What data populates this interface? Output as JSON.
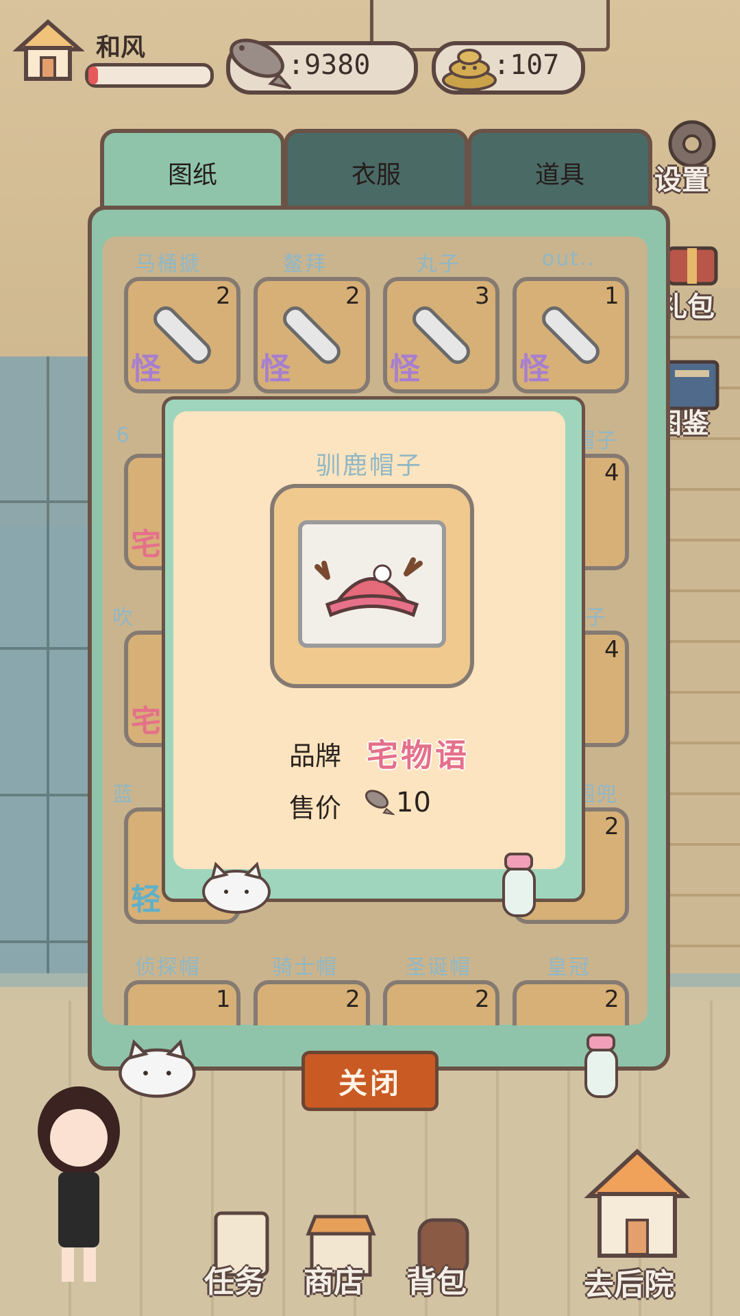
{
  "player": {
    "name": "和风",
    "xp_fraction": 0.08
  },
  "currency": {
    "fish": ":9380",
    "poop": ":107"
  },
  "side_buttons": [
    "设置",
    "礼包",
    "图鉴"
  ],
  "tabs": [
    {
      "label": "图纸",
      "active": true
    },
    {
      "label": "衣服",
      "active": false
    },
    {
      "label": "道具",
      "active": false
    }
  ],
  "grid": {
    "row1": [
      {
        "name": "马桶搋",
        "count": "2",
        "brand": "怪"
      },
      {
        "name": "鳌拜",
        "count": "2",
        "brand": "怪"
      },
      {
        "name": "丸子",
        "count": "3",
        "brand": "怪"
      },
      {
        "name": "out..",
        "count": "1",
        "brand": "怪"
      }
    ],
    "row2": [
      {
        "name": "6",
        "count": "",
        "brand": "宅"
      },
      {
        "name": "帽子",
        "count": "4",
        "brand": ""
      }
    ],
    "row3": [
      {
        "name": "吹",
        "count": "",
        "brand": "宅"
      },
      {
        "name": "子",
        "count": "4",
        "brand": ""
      }
    ],
    "row4": [
      {
        "name": "蓝",
        "count": "",
        "brand": "轻"
      },
      {
        "name": "围兜",
        "count": "2",
        "brand": ""
      }
    ],
    "row5": [
      {
        "name": "侦探帽",
        "count": "1"
      },
      {
        "name": "骑士帽",
        "count": "2"
      },
      {
        "name": "圣诞帽",
        "count": "2"
      },
      {
        "name": "皇冠",
        "count": "2"
      }
    ]
  },
  "popup": {
    "title": "驯鹿帽子",
    "brand_label": "品牌",
    "brand_value": "宅物语",
    "price_label": "售价",
    "price_value": "10"
  },
  "close_label": "关闭",
  "bottom_nav": [
    "任务",
    "商店",
    "背包",
    "去后院"
  ],
  "colors": {
    "panel": "#8fc4aa",
    "tab_inactive": "#4a6a66",
    "slot": "#d6b077",
    "close": "#c95a24",
    "brand_pink": "#e5708a",
    "brand_purple": "#a77fcf"
  }
}
